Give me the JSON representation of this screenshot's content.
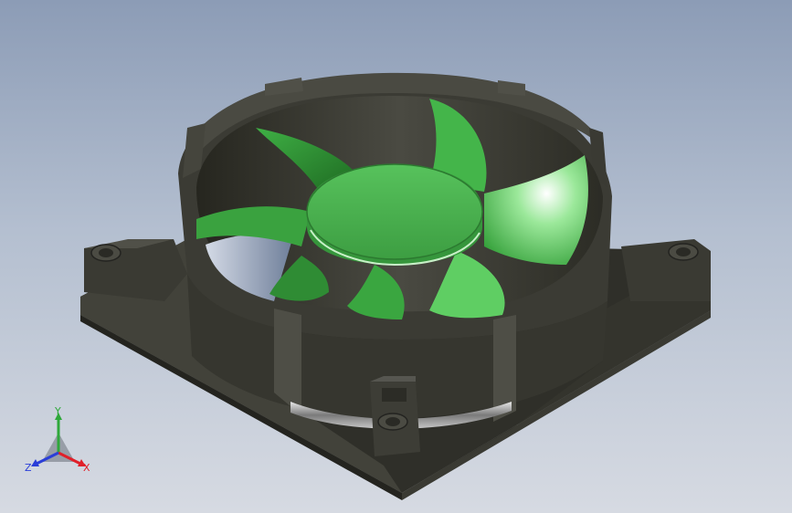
{
  "viewport": {
    "background_top": "#8c9cb6",
    "background_bottom": "#d6dae2"
  },
  "model": {
    "housing_color": "#3d3d35",
    "blade_color": "#3fb045",
    "hub_color": "#4bb752"
  },
  "triad": {
    "x_label": "X",
    "y_label": "Y",
    "z_label": "Z",
    "x_color": "#e0202a",
    "y_color": "#2ea83a",
    "z_color": "#2a3ed8"
  }
}
